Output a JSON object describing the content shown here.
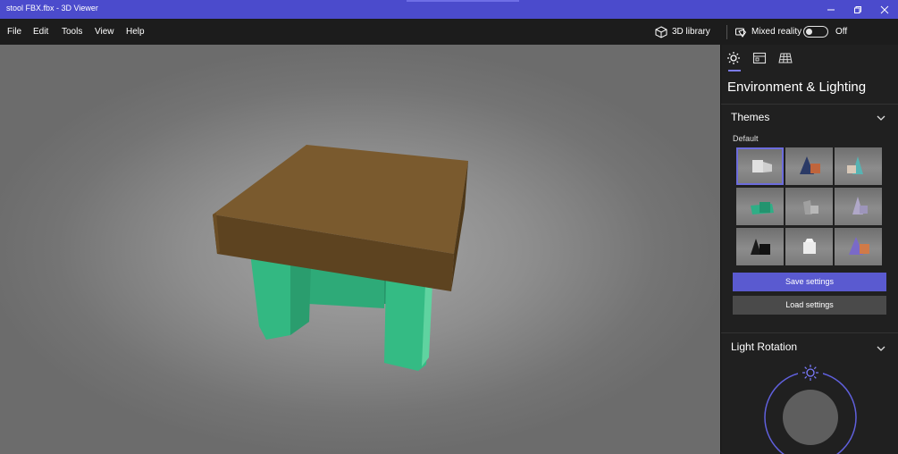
{
  "window": {
    "title": "stool FBX.fbx - 3D Viewer"
  },
  "menu": {
    "items": [
      "File",
      "Edit",
      "Tools",
      "View",
      "Help"
    ],
    "library_label": "3D library",
    "mixed_reality_label": "Mixed reality",
    "mixed_reality_state": "Off"
  },
  "panel": {
    "title": "Environment & Lighting",
    "tabs": [
      "lighting-tab",
      "display-tab",
      "grid-tab"
    ],
    "themes": {
      "section_title": "Themes",
      "default_label": "Default",
      "selected_index": 0
    },
    "save_label": "Save settings",
    "load_label": "Load settings",
    "light_rotation_title": "Light Rotation"
  },
  "colors": {
    "titlebar": "#4b4bcc",
    "accent": "#5a5ad0",
    "seat": "#7a5a2e",
    "legs": "#2fb07a"
  }
}
